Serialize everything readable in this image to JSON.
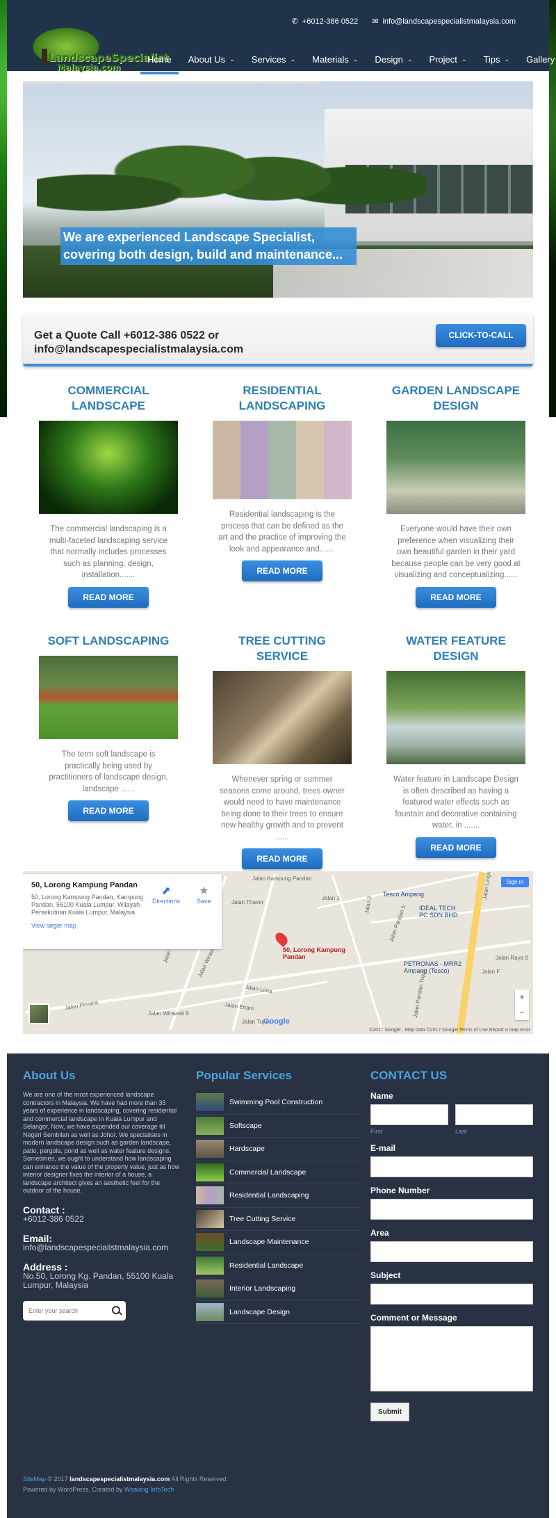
{
  "header": {
    "phone": "+6012-386 0522",
    "email": "info@landscapespecialistmalaysia.com",
    "logo_line1": "LandscapeSpecialist",
    "logo_line2": "Malaysia.com",
    "nav": [
      {
        "label": "Home",
        "active": true,
        "dropdown": false
      },
      {
        "label": "About Us",
        "dropdown": true
      },
      {
        "label": "Services",
        "dropdown": true
      },
      {
        "label": "Materials",
        "dropdown": true
      },
      {
        "label": "Design",
        "dropdown": true
      },
      {
        "label": "Project",
        "dropdown": true
      },
      {
        "label": "Tips",
        "dropdown": true
      },
      {
        "label": "Gallery",
        "dropdown": false
      }
    ]
  },
  "hero": {
    "caption": "We are experienced Landscape Specialist, covering both design, build and maintenance..."
  },
  "quote": {
    "text": "Get a Quote Call +6012-386 0522 or info@landscapespecialistmalaysia.com",
    "button": "CLICK-TO-CALL"
  },
  "services": [
    {
      "title": "COMMERCIAL LANDSCAPE",
      "text": "The commercial landscaping is a multi-faceted landscaping service that normally includes processes such as planning, design, installation.......",
      "button": "READ MORE"
    },
    {
      "title": "RESIDENTIAL LANDSCAPING",
      "text": "Residential landscaping is the process that can be defined as the art and the practice of improving the look and appearance and.......",
      "button": "READ MORE"
    },
    {
      "title": "GARDEN LANDSCAPE DESIGN",
      "text": "Everyone would have their own preference when visualizing their own beautiful garden in their yard because people can be very good at visualizing and conceptualizing......",
      "button": "READ MORE"
    },
    {
      "title": "SOFT LANDSCAPING",
      "text": "The term soft landscape is practically being used by practitioners of landscape design, landscape ......",
      "button": "READ MORE"
    },
    {
      "title": "TREE CUTTING SERVICE",
      "text": "Whenever spring or summer seasons come around, trees owner would need to have maintenance being done to their trees to ensure new healthy growth and to prevent ......",
      "button": "READ MORE"
    },
    {
      "title": "WATER FEATURE DESIGN",
      "text": "Water feature in Landscape Design is often described as having a featured water effects such as fountain and decorative containing water, in .......",
      "button": "READ MORE"
    }
  ],
  "map": {
    "place": "50, Lorong Kampung Pandan",
    "address": "50, Lorong Kampung Pandan, Kampung Pandan, 55100 Kuala Lumpur, Wilayah Persekutuan Kuala Lumpur, Malaysia",
    "larger": "View larger map",
    "directions": "Directions",
    "save": "Save",
    "signin": "Sign in",
    "pin_label": "50, Lorong Kampung Pandan",
    "poi1": "Tesco Ampang",
    "poi2": "IDEAL TECH PC SDN BHD",
    "poi3": "PETRONAS - MRR2 Ampang (Tesco)",
    "streets": [
      "Jalan Kampung Pandan",
      "Jalan Thaver",
      "Jalan Perwira",
      "Jalan Wirawati 9",
      "Jalan Lima",
      "Jalan Enam",
      "Jalan Tujuh",
      "Jalan Lingkaran Tengah 2",
      "Jalan Raya 9",
      "Jalan F",
      "Jalan Pandan 5",
      "Jalan Pandan Tujuh",
      "Jalan 1",
      "Jalan 2",
      "Jalan Wirawati",
      "Jalan Wirawati 3"
    ],
    "glogo": "Google",
    "footer": "©2017 Google · Map data ©2017 Google   Terms of Use   Report a map error"
  },
  "footer": {
    "about_title": "About Us",
    "about_text": "We are one of the most experienced landscape contractors in Malaysia. We have had more than 35 years of experience in landscaping, covering residential and commercial landscape in Kuala Lumpur and Selangor. Now, we have expended our coverage till Negeri Sembilan as well as Johor. We specialises in modern landscape design such as garden landscape, patio, pergola, pond as well as water feature designs. Sometimes, we ought to understand how landscaping can enhance the value of the property value, just as how interior designer fixes the interior of a house, a landscape architect gives an aesthetic feel for the outdoor of the house.",
    "contact_label": "Contact :",
    "contact_val": "+6012-386 0522",
    "email_label": "Email:",
    "email_val": "info@landscapespecialistmalaysia.com",
    "address_label": "Address :",
    "address_val": "No.50, Lorong Kg. Pandan, 55100 Kuala Lumpur, Malaysia",
    "search_placeholder": "Enter your search",
    "popular_title": "Popular Services",
    "popular": [
      "Swimming Pool Construction",
      "Softscape",
      "Hardscape",
      "Commercial Landscape",
      "Residential Landscaping",
      "Tree Cutting Service",
      "Landscape Maintenance",
      "Residential Landscape",
      "Interior Landscaping",
      "Landscape Design"
    ],
    "contact_title": "CONTACT US",
    "form": {
      "name": "Name",
      "first": "First",
      "last": "Last",
      "email": "E-mail",
      "phone": "Phone Number",
      "area": "Area",
      "subject": "Subject",
      "message": "Comment or Message",
      "submit": "Submit"
    },
    "copy1_a": "SiteMap",
    "copy1_b": "© 2017",
    "copy1_c": "landscapespecialistmalaysia.com",
    "copy1_d": "All Rights Reserved.",
    "copy2_a": "Powered by WordPress. Created by",
    "copy2_b": "Weaving InfoTech"
  },
  "colors": {
    "accent": "#2f7fb5",
    "header": "#21334a",
    "footer": "#283243",
    "button": "#2474c8"
  }
}
